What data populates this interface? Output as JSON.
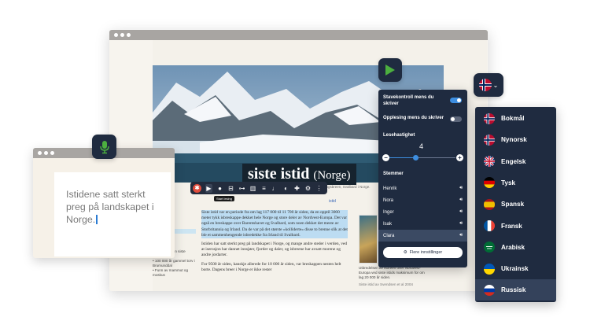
{
  "article": {
    "title": "siste istid",
    "title_suffix": "(Norge)",
    "caption": "Kongsbreen, Svalbard i Norge.",
    "breadcrumb": "istid",
    "left_col_lines": [
      "tekstkilde",
      "inn finnes",
      "sjon",
      "ørske"
    ],
    "left_col_list": [
      "det sisteste",
      "istiden",
      "tider under den siste istiden",
      "• 100 000 år gammel torv i Brumunddal",
      "• Funn av mammut og moskus"
    ],
    "paragraphs": [
      "Siste istid var en periode fra om lag 117 000 til 11 700 år siden, da en opptil 3000 meter tykk isbreskappe dekket hele Norge og store deler av Nordvest-Europa. Det var også en breskappe over Barentshavet og Svalbard, som noen dekket det meste av Storbritannia og Irland. Da de var på det største «kolliderte» disse to brenne slik at det ble et sammenhengende isbredekke fra Irland til Svalbard.",
      "Istiden har satt sterkt preg på landskapet i Norge, og mange andre steder i verden, ved at iserosjon har dannet innsjøer, fjorder og daler, og isbreene har avsatt morene og andre jordarter.",
      "For 9500 år siden, kanskje allerede for 10 000 år siden, var breskappen nesten helt borte. Dagens breer i Norge er ikke rester"
    ],
    "figure_caption": "Utbredelsen av isbreen over Nordvest-Europa ved siste istids maksimum for om lag 20 000 år siden.",
    "figure_credit": "Siste istid av Svendsen et al 2004"
  },
  "toolbar": {
    "logo": "✱",
    "tooltip": "Start lesing"
  },
  "dictation": {
    "text": "Istidene satt sterkt preg på landskapet i Norge."
  },
  "settings": {
    "spellcheck_label": "Stavekontroll mens du skriver",
    "readaloud_label": "Opplesing mens du skriver",
    "speed_label": "Lesehastighet",
    "speed_value": "4",
    "speed_fraction": 0.4,
    "voices_label": "Stemmer",
    "voices": [
      "Henrik",
      "Nora",
      "Inger",
      "Isak",
      "Clara"
    ],
    "selected_voice": "Clara",
    "more_settings": "Flere innstillinger"
  },
  "languages": {
    "items": [
      {
        "name": "Bokmål",
        "flag": "norway-flag"
      },
      {
        "name": "Nynorsk",
        "flag": "norway-flag"
      },
      {
        "name": "Engelsk",
        "flag": "uk-flag"
      },
      {
        "name": "Tysk",
        "flag": "germany-flag"
      },
      {
        "name": "Spansk",
        "flag": "spain-flag"
      },
      {
        "name": "Fransk",
        "flag": "france-flag"
      },
      {
        "name": "Arabisk",
        "flag": "saudi-flag"
      },
      {
        "name": "Ukrainsk",
        "flag": "ukraine-flag"
      },
      {
        "name": "Russisk",
        "flag": "russia-flag"
      }
    ],
    "selected": "Russisk"
  },
  "colors": {
    "panel": "#1f2b40",
    "accent": "#3d8ee0",
    "play": "#4caf3f",
    "mic": "#4caf3f"
  }
}
